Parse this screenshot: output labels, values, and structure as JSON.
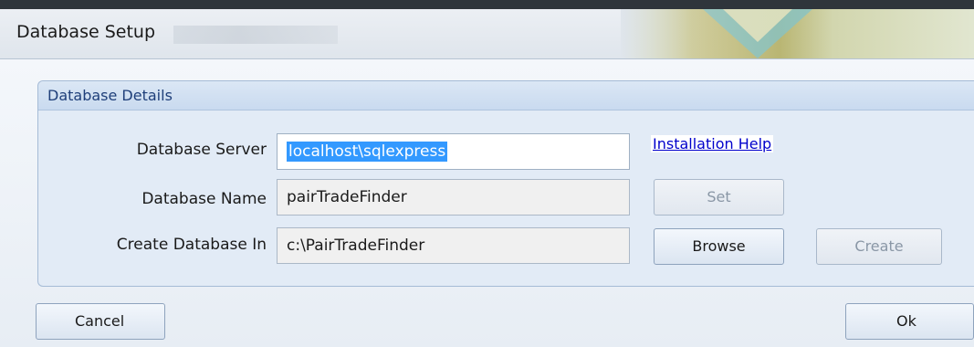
{
  "window": {
    "title": "Database Setup"
  },
  "group": {
    "title": "Database Details"
  },
  "fields": {
    "server": {
      "label": "Database Server",
      "value": "localhost\\sqlexpress"
    },
    "name": {
      "label": "Database Name",
      "value": "pairTradeFinder"
    },
    "location": {
      "label": "Create Database In",
      "value": "c:\\PairTradeFinder"
    }
  },
  "links": {
    "installation_help": "Installation Help"
  },
  "buttons": {
    "set": "Set",
    "browse": "Browse",
    "create": "Create",
    "cancel": "Cancel",
    "ok": "Ok"
  },
  "colors": {
    "link": "#0000cc",
    "selection": "#3399ff",
    "group_title": "#1f3f7a"
  }
}
